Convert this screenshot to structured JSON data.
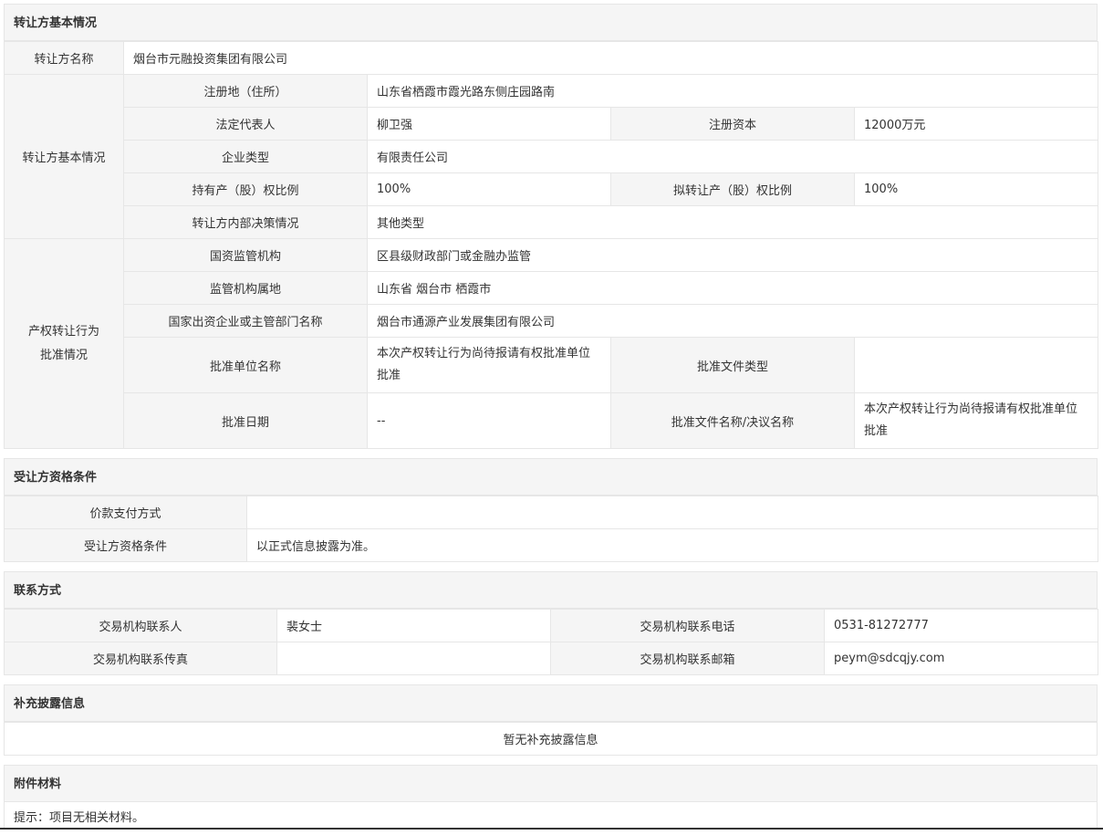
{
  "transferor": {
    "section_title": "转让方基本情况",
    "name_label": "转让方名称",
    "name_value": "烟台市元融投资集团有限公司",
    "basic_group_label": "转让方基本情况",
    "reg_address_label": "注册地（住所）",
    "reg_address_value": "山东省栖霞市霞光路东侧庄园路南",
    "legal_rep_label": "法定代表人",
    "legal_rep_value": "柳卫强",
    "reg_capital_label": "注册资本",
    "reg_capital_value": "12000万元",
    "company_type_label": "企业类型",
    "company_type_value": "有限责任公司",
    "holding_ratio_label": "持有产（股）权比例",
    "holding_ratio_value": "100%",
    "transfer_ratio_label": "拟转让产（股）权比例",
    "transfer_ratio_value": "100%",
    "decision_label": "转让方内部决策情况",
    "decision_value": "其他类型",
    "approval_group_label_1": "产权转让行为",
    "approval_group_label_2": "批准情况",
    "supervisor_label": "国资监管机构",
    "supervisor_value": "区县级财政部门或金融办监管",
    "supervisor_location_label": "监管机构属地",
    "supervisor_location_value": "山东省 烟台市 栖霞市",
    "investor_label": "国家出资企业或主管部门名称",
    "investor_value": "烟台市通源产业发展集团有限公司",
    "approver_label": "批准单位名称",
    "approver_value": "本次产权转让行为尚待报请有权批准单位批准",
    "approval_doc_type_label": "批准文件类型",
    "approval_doc_type_value": "",
    "approval_date_label": "批准日期",
    "approval_date_value": "--",
    "approval_doc_name_label": "批准文件名称/决议名称",
    "approval_doc_name_value": "本次产权转让行为尚待报请有权批准单位批准"
  },
  "transferee": {
    "section_title": "受让方资格条件",
    "payment_label": "价款支付方式",
    "payment_value": "",
    "qualification_label": "受让方资格条件",
    "qualification_value": "以正式信息披露为准。"
  },
  "contact": {
    "section_title": "联系方式",
    "person_label": "交易机构联系人",
    "person_value": "裴女士",
    "phone_label": "交易机构联系电话",
    "phone_value": "0531-81272777",
    "fax_label": "交易机构联系传真",
    "fax_value": "",
    "email_label": "交易机构联系邮箱",
    "email_value": "peym@sdcqjy.com"
  },
  "supplement": {
    "section_title": "补充披露信息",
    "content": "暂无补充披露信息"
  },
  "attachments": {
    "section_title": "附件材料",
    "note": "提示：项目无相关材料。"
  }
}
